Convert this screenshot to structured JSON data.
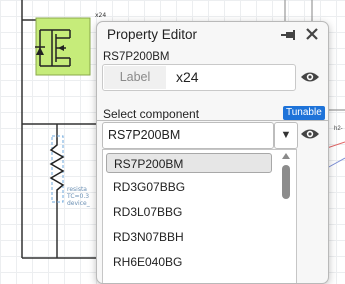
{
  "schematic": {
    "component_tag": "x24",
    "resistor_lines": [
      "resista",
      "TC=0.3",
      "device_"
    ],
    "side_label": "h2-"
  },
  "editor": {
    "title": "Property Editor",
    "component_name": "RS7P200BM",
    "label_field": {
      "chip": "Label",
      "value": "x24"
    },
    "select_component_label": "Select component",
    "tunable_badge": "Tunable",
    "selected_value": "RS7P200BM",
    "options": [
      "RS7P200BM",
      "RD3G07BBG",
      "RD3L07BBG",
      "RD3N07BBH",
      "RH6E040BG"
    ]
  },
  "colors": {
    "accent": "#1e73d9",
    "component_fill": "#c6ec7a"
  },
  "icons": {
    "pin": "pin-icon",
    "close": "close-icon",
    "eye": "eye-icon",
    "dropdown": "chevron-down-icon"
  }
}
